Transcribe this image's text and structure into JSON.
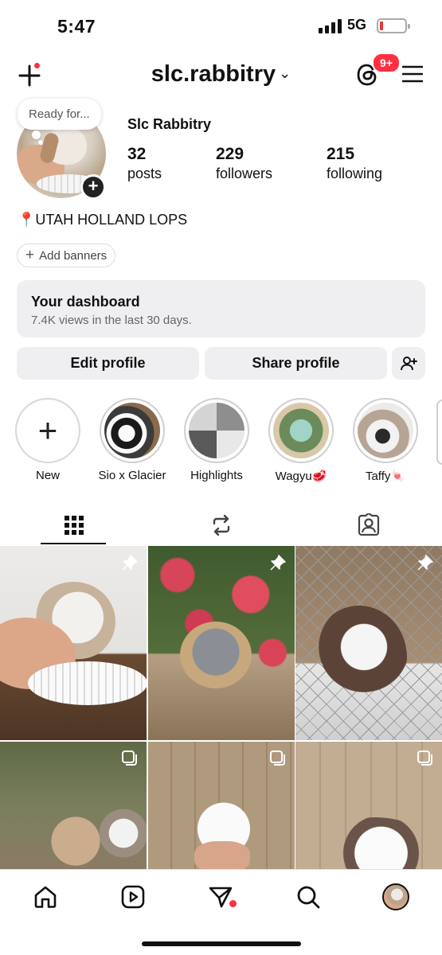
{
  "status": {
    "time": "5:47",
    "network": "5G",
    "battery_color": "#e53935"
  },
  "header": {
    "create_icon": "plus-icon",
    "username": "slc.rabbitry",
    "threads_icon": "threads-icon",
    "threads_badge": "9+",
    "menu_icon": "hamburger-menu-icon"
  },
  "profile": {
    "note": "Ready for...",
    "display_name": "Slc Rabbitry",
    "stats": [
      {
        "num": "32",
        "label": "posts"
      },
      {
        "num": "229",
        "label": "followers"
      },
      {
        "num": "215",
        "label": "following"
      }
    ],
    "bio_pin": "📍",
    "bio": "UTAH HOLLAND LOPS",
    "banners_label": "Add banners"
  },
  "dashboard": {
    "title": "Your dashboard",
    "subtitle": "7.4K views in the last 30 days."
  },
  "actions": {
    "edit": "Edit profile",
    "share": "Share profile",
    "discover_icon": "add-person-icon"
  },
  "highlights": [
    {
      "label": "New"
    },
    {
      "label": "Sio x Glacier"
    },
    {
      "label": "Highlights"
    },
    {
      "label": "Wagyu🥩"
    },
    {
      "label": "Taffy🍬"
    }
  ],
  "tabs": [
    "grid-icon",
    "reels-repost-icon",
    "tagged-icon"
  ],
  "grid_overlays": [
    "pin-icon",
    "pin-icon",
    "pin-icon",
    "carousel-icon",
    "carousel-icon",
    "carousel-icon"
  ],
  "bottom_nav": [
    "home-icon",
    "reels-icon",
    "send-icon",
    "search-icon",
    "profile-avatar"
  ],
  "accent": "#ff3040"
}
